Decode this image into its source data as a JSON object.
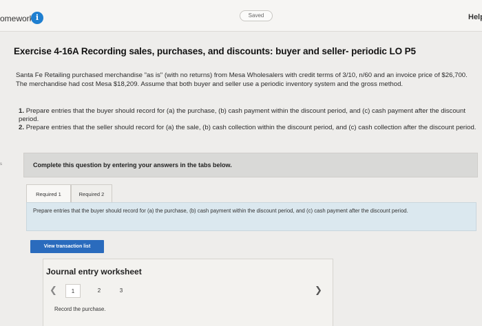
{
  "header": {
    "app_title": "omework",
    "info_icon": "info-icon",
    "saved_label": "Saved",
    "help_label": "Help"
  },
  "exercise": {
    "title": "Exercise 4-16A Recording sales, purchases, and discounts: buyer and seller- periodic LO P5",
    "problem_text": "Santa Fe Retailing purchased merchandise \"as is\" (with no returns) from Mesa Wholesalers with credit terms of 3/10, n/60 and an invoice price of $26,700. The merchandise had cost Mesa $18,209. Assume that both buyer and seller use a periodic inventory system and the gross method.",
    "requirements": [
      {
        "num": "1.",
        "text": "Prepare entries that the buyer should record for (a) the purchase, (b) cash payment within the discount period, and (c) cash payment after the discount period."
      },
      {
        "num": "2.",
        "text": "Prepare entries that the seller should record for (a) the sale, (b) cash collection within the discount period, and (c) cash collection after the discount period."
      }
    ]
  },
  "left_margin_mark": "s",
  "instructions": {
    "text": "Complete this question by entering your answers in the tabs below."
  },
  "tabs": [
    {
      "label": "Required 1"
    },
    {
      "label": "Required 2"
    }
  ],
  "panel": {
    "text": "Prepare entries that the buyer should record for (a) the purchase, (b) cash payment within the discount period, and (c) cash payment after the discount period."
  },
  "buttons": {
    "view_transaction_list": "View transaction list"
  },
  "journal": {
    "title": "Journal entry worksheet",
    "prev_icon": "chevron-left-icon",
    "next_icon": "chevron-right-icon",
    "pages": [
      "1",
      "2",
      "3"
    ],
    "current_page": "1",
    "record_text": "Record the purchase."
  }
}
